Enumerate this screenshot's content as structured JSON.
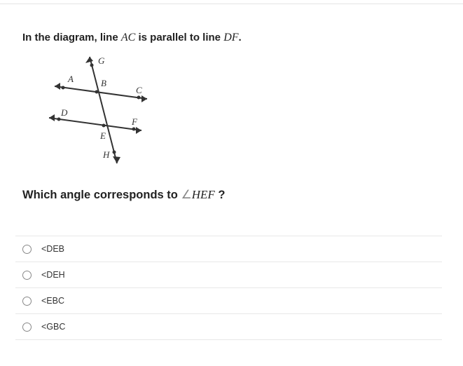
{
  "question": {
    "intro_prefix": "In the diagram, line ",
    "intro_ac": "AC",
    "intro_mid": " is parallel to line ",
    "intro_df": "DF",
    "intro_suffix": ".",
    "prompt_prefix": "Which angle corresponds to ",
    "prompt_angle": "∠",
    "prompt_hef": "HEF",
    "prompt_suffix": " ?"
  },
  "diagram": {
    "labels": {
      "A": "A",
      "B": "B",
      "C": "C",
      "D": "D",
      "E": "E",
      "F": "F",
      "G": "G",
      "H": "H"
    }
  },
  "options": [
    {
      "label": "<DEB"
    },
    {
      "label": "<DEH"
    },
    {
      "label": "<EBC"
    },
    {
      "label": "<GBC"
    }
  ]
}
